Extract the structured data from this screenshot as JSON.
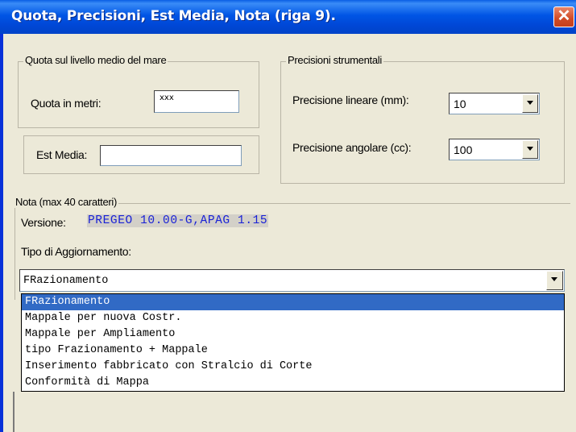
{
  "window": {
    "title": "Quota, Precisioni, Est Media, Nota  (riga 9).",
    "close_label": "✕"
  },
  "quota": {
    "legend": "Quota sul livello medio del mare",
    "label": "Quota in metri:",
    "value": "xxx"
  },
  "est_media": {
    "label": "Est Media:",
    "value": ""
  },
  "precisioni": {
    "legend": "Precisioni strumentali",
    "lineare_label": "Precisione lineare (mm):",
    "lineare_value": "10",
    "angolare_label": "Precisione  angolare (cc):",
    "angolare_value": "100"
  },
  "nota": {
    "legend": "Nota (max 40 caratteri)",
    "versione_label": "Versione:",
    "versione_value": "PREGEO 10.00-G,APAG 1.15",
    "tipo_label": "Tipo di Aggiornamento:",
    "tipo_selected": "FRazionamento",
    "tipo_options": [
      "FRazionamento",
      "Mappale per nuova Costr.",
      "Mappale per Ampliamento",
      "tipo Frazionamento + Mappale",
      "Inserimento fabbricato con Stralcio di Corte",
      "Conformità di Mappa"
    ]
  },
  "colors": {
    "title_bar": "#0055e5",
    "selection": "#316ac5",
    "versione_text": "#1a22d6",
    "dialog_bg": "#ece9d8"
  }
}
